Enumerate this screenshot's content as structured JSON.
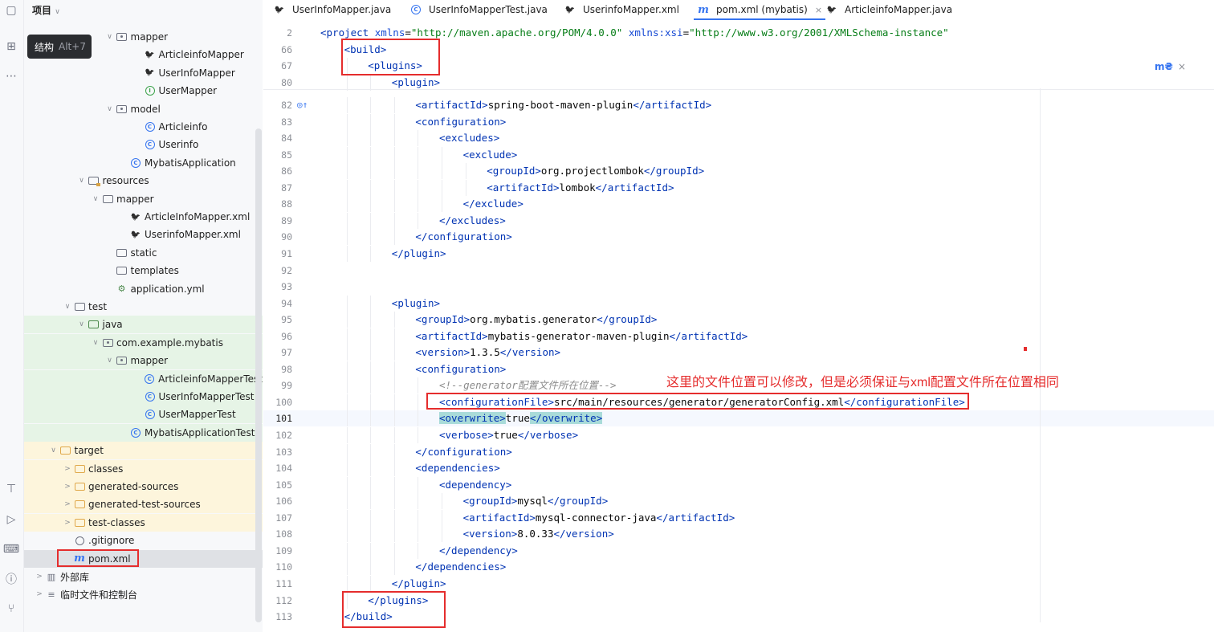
{
  "sidebar": {
    "header": "项目",
    "tooltip": {
      "label": "结构",
      "shortcut": "Alt+7"
    },
    "tree": [
      {
        "label": "mapper",
        "icon": "package-folder-icon",
        "indent": 5,
        "chev": "∨"
      },
      {
        "label": "ArticleinfoMapper",
        "icon": "mybatis-bird-icon",
        "indent": 7
      },
      {
        "label": "UserInfoMapper",
        "icon": "mybatis-bird-icon",
        "indent": 7
      },
      {
        "label": "UserMapper",
        "icon": "interface-icon",
        "indent": 7
      },
      {
        "label": "model",
        "icon": "package-folder-icon",
        "indent": 5,
        "chev": "∨"
      },
      {
        "label": "Articleinfo",
        "icon": "class-icon",
        "indent": 7
      },
      {
        "label": "Userinfo",
        "icon": "class-icon",
        "indent": 7
      },
      {
        "label": "MybatisApplication",
        "icon": "spring-class-icon",
        "indent": 6
      },
      {
        "label": "resources",
        "icon": "resources-folder-icon",
        "indent": 3,
        "chev": "∨"
      },
      {
        "label": "mapper",
        "icon": "folder-icon",
        "indent": 4,
        "chev": "∨"
      },
      {
        "label": "ArticleInfoMapper.xml",
        "icon": "mybatis-bird-icon",
        "indent": 6
      },
      {
        "label": "UserinfoMapper.xml",
        "icon": "mybatis-bird-icon",
        "indent": 6
      },
      {
        "label": "static",
        "icon": "folder-icon",
        "indent": 5
      },
      {
        "label": "templates",
        "icon": "folder-icon",
        "indent": 5
      },
      {
        "label": "application.yml",
        "icon": "yaml-icon",
        "indent": 5
      },
      {
        "label": "test",
        "icon": "folder-icon",
        "indent": 2,
        "chev": "∨"
      },
      {
        "label": "java",
        "icon": "test-folder-icon",
        "indent": 3,
        "chev": "∨",
        "bg": "green"
      },
      {
        "label": "com.example.mybatis",
        "icon": "package-folder-icon",
        "indent": 4,
        "chev": "∨",
        "bg": "green"
      },
      {
        "label": "mapper",
        "icon": "package-folder-icon",
        "indent": 5,
        "chev": "∨",
        "bg": "green"
      },
      {
        "label": "ArticleinfoMapperTest",
        "icon": "test-class-icon",
        "indent": 7,
        "bg": "green"
      },
      {
        "label": "UserInfoMapperTest",
        "icon": "test-class-icon",
        "indent": 7,
        "bg": "green"
      },
      {
        "label": "UserMapperTest",
        "icon": "test-class-icon",
        "indent": 7,
        "bg": "green"
      },
      {
        "label": "MybatisApplicationTests",
        "icon": "test-class-icon",
        "indent": 6,
        "bg": "green"
      },
      {
        "label": "target",
        "icon": "target-folder-icon",
        "indent": 1,
        "chev": "∨",
        "bg": "yellow"
      },
      {
        "label": "classes",
        "icon": "target-folder-icon",
        "indent": 2,
        "chev": ">",
        "bg": "yellow"
      },
      {
        "label": "generated-sources",
        "icon": "target-folder-icon",
        "indent": 2,
        "chev": ">",
        "bg": "yellow"
      },
      {
        "label": "generated-test-sources",
        "icon": "target-folder-icon",
        "indent": 2,
        "chev": ">",
        "bg": "yellow"
      },
      {
        "label": "test-classes",
        "icon": "target-folder-icon",
        "indent": 2,
        "chev": ">",
        "bg": "yellow"
      },
      {
        "label": ".gitignore",
        "icon": "gitignore-icon",
        "indent": 2
      },
      {
        "label": "pom.xml",
        "icon": "maven-icon",
        "indent": 2,
        "bg": "selected"
      },
      {
        "label": "外部库",
        "icon": "library-icon",
        "indent": 0,
        "chev": ">"
      },
      {
        "label": "临时文件和控制台",
        "icon": "scratch-icon",
        "indent": 0,
        "chev": ">"
      }
    ]
  },
  "tabs": [
    {
      "label": "UserInfoMapper.java",
      "icon": "mybatis-bird-icon"
    },
    {
      "label": "UserInfoMapperTest.java",
      "icon": "test-class-icon"
    },
    {
      "label": "UserinfoMapper.xml",
      "icon": "mybatis-bird-icon"
    },
    {
      "label": "pom.xml (mybatis)",
      "icon": "maven-icon",
      "active": true,
      "close": "×"
    },
    {
      "label": "ArticleinfoMapper.java",
      "icon": "mybatis-bird-icon"
    }
  ],
  "editor": {
    "sticky": [
      {
        "num": "2",
        "indent": 0,
        "html": [
          [
            "tag",
            "<project "
          ],
          [
            "attr",
            "xmlns"
          ],
          [
            "",
            "="
          ],
          [
            "str",
            "\"http://maven.apache.org/POM/4.0.0\""
          ],
          [
            "",
            " "
          ],
          [
            "attr",
            "xmlns:xsi"
          ],
          [
            "",
            "="
          ],
          [
            "str",
            "\"http://www.w3.org/2001/XMLSchema-instance\""
          ]
        ]
      },
      {
        "num": "66",
        "indent": 1,
        "html": [
          [
            "tag",
            "<build>"
          ]
        ]
      },
      {
        "num": "67",
        "indent": 2,
        "html": [
          [
            "tag",
            "<plugins>"
          ]
        ]
      },
      {
        "num": "80",
        "indent": 3,
        "html": [
          [
            "tag",
            "<plugin>"
          ]
        ]
      }
    ],
    "lines": [
      {
        "num": "82",
        "indent": 4,
        "gutter": "override-icon",
        "html": [
          [
            "tag",
            "<artifactId>"
          ],
          [
            "",
            "spring-boot-maven-plugin"
          ],
          [
            "tag",
            "</artifactId>"
          ]
        ]
      },
      {
        "num": "83",
        "indent": 4,
        "html": [
          [
            "tag",
            "<configuration>"
          ]
        ]
      },
      {
        "num": "84",
        "indent": 5,
        "html": [
          [
            "tag",
            "<excludes>"
          ]
        ]
      },
      {
        "num": "85",
        "indent": 6,
        "html": [
          [
            "tag",
            "<exclude>"
          ]
        ]
      },
      {
        "num": "86",
        "indent": 7,
        "html": [
          [
            "tag",
            "<groupId>"
          ],
          [
            "",
            "org.projectlombok"
          ],
          [
            "tag",
            "</groupId>"
          ]
        ]
      },
      {
        "num": "87",
        "indent": 7,
        "html": [
          [
            "tag",
            "<artifactId>"
          ],
          [
            "",
            "lombok"
          ],
          [
            "tag",
            "</artifactId>"
          ]
        ]
      },
      {
        "num": "88",
        "indent": 6,
        "html": [
          [
            "tag",
            "</exclude>"
          ]
        ]
      },
      {
        "num": "89",
        "indent": 5,
        "html": [
          [
            "tag",
            "</excludes>"
          ]
        ]
      },
      {
        "num": "90",
        "indent": 4,
        "html": [
          [
            "tag",
            "</configuration>"
          ]
        ]
      },
      {
        "num": "91",
        "indent": 3,
        "html": [
          [
            "tag",
            "</plugin>"
          ]
        ]
      },
      {
        "num": "92",
        "indent": 0,
        "html": []
      },
      {
        "num": "93",
        "indent": 0,
        "html": []
      },
      {
        "num": "94",
        "indent": 3,
        "html": [
          [
            "tag",
            "<plugin>"
          ]
        ]
      },
      {
        "num": "95",
        "indent": 4,
        "html": [
          [
            "tag",
            "<groupId>"
          ],
          [
            "",
            "org.mybatis.generator"
          ],
          [
            "tag",
            "</groupId>"
          ]
        ]
      },
      {
        "num": "96",
        "indent": 4,
        "html": [
          [
            "tag",
            "<artifactId>"
          ],
          [
            "",
            "mybatis-generator-maven-plugin"
          ],
          [
            "tag",
            "</artifactId>"
          ]
        ]
      },
      {
        "num": "97",
        "indent": 4,
        "html": [
          [
            "tag",
            "<version>"
          ],
          [
            "",
            "1.3.5"
          ],
          [
            "tag",
            "</version>"
          ]
        ]
      },
      {
        "num": "98",
        "indent": 4,
        "html": [
          [
            "tag",
            "<configuration>"
          ]
        ]
      },
      {
        "num": "99",
        "indent": 5,
        "html": [
          [
            "cmt",
            "<!--generator配置文件所在位置-->"
          ]
        ]
      },
      {
        "num": "100",
        "indent": 5,
        "html": [
          [
            "tag",
            "<configurationFile>"
          ],
          [
            "",
            "src/main/resources/generator/generatorConfig.xml"
          ],
          [
            "tag",
            "</configurationFile>"
          ]
        ]
      },
      {
        "num": "101",
        "indent": 5,
        "current": true,
        "html": [
          [
            "tag hl",
            "<overwrite>"
          ],
          [
            "",
            "true"
          ],
          [
            "tag hl",
            "</overwrite>"
          ]
        ]
      },
      {
        "num": "102",
        "indent": 5,
        "html": [
          [
            "tag",
            "<verbose>"
          ],
          [
            "",
            "true"
          ],
          [
            "tag",
            "</verbose>"
          ]
        ]
      },
      {
        "num": "103",
        "indent": 4,
        "html": [
          [
            "tag",
            "</configuration>"
          ]
        ]
      },
      {
        "num": "104",
        "indent": 4,
        "html": [
          [
            "tag",
            "<dependencies>"
          ]
        ]
      },
      {
        "num": "105",
        "indent": 5,
        "html": [
          [
            "tag",
            "<dependency>"
          ]
        ]
      },
      {
        "num": "106",
        "indent": 6,
        "html": [
          [
            "tag",
            "<groupId>"
          ],
          [
            "",
            "mysql"
          ],
          [
            "tag",
            "</groupId>"
          ]
        ]
      },
      {
        "num": "107",
        "indent": 6,
        "html": [
          [
            "tag",
            "<artifactId>"
          ],
          [
            "",
            "mysql-connector-java"
          ],
          [
            "tag",
            "</artifactId>"
          ]
        ]
      },
      {
        "num": "108",
        "indent": 6,
        "html": [
          [
            "tag",
            "<version>"
          ],
          [
            "",
            "8.0.33"
          ],
          [
            "tag",
            "</version>"
          ]
        ]
      },
      {
        "num": "109",
        "indent": 5,
        "html": [
          [
            "tag",
            "</dependency>"
          ]
        ]
      },
      {
        "num": "110",
        "indent": 4,
        "html": [
          [
            "tag",
            "</dependencies>"
          ]
        ]
      },
      {
        "num": "111",
        "indent": 3,
        "html": [
          [
            "tag",
            "</plugin>"
          ]
        ]
      },
      {
        "num": "112",
        "indent": 2,
        "html": [
          [
            "tag",
            "</plugins>"
          ]
        ]
      },
      {
        "num": "113",
        "indent": 1,
        "html": [
          [
            "tag",
            "</build>"
          ]
        ]
      }
    ],
    "annotation": "这里的文件位置可以修改，但是必须保证与xml配置文件所在位置相同"
  },
  "colors": {
    "accent": "#3574f0",
    "annotation_red": "#e52d2d",
    "tag_blue": "#0033b3",
    "string_green": "#067d17"
  }
}
